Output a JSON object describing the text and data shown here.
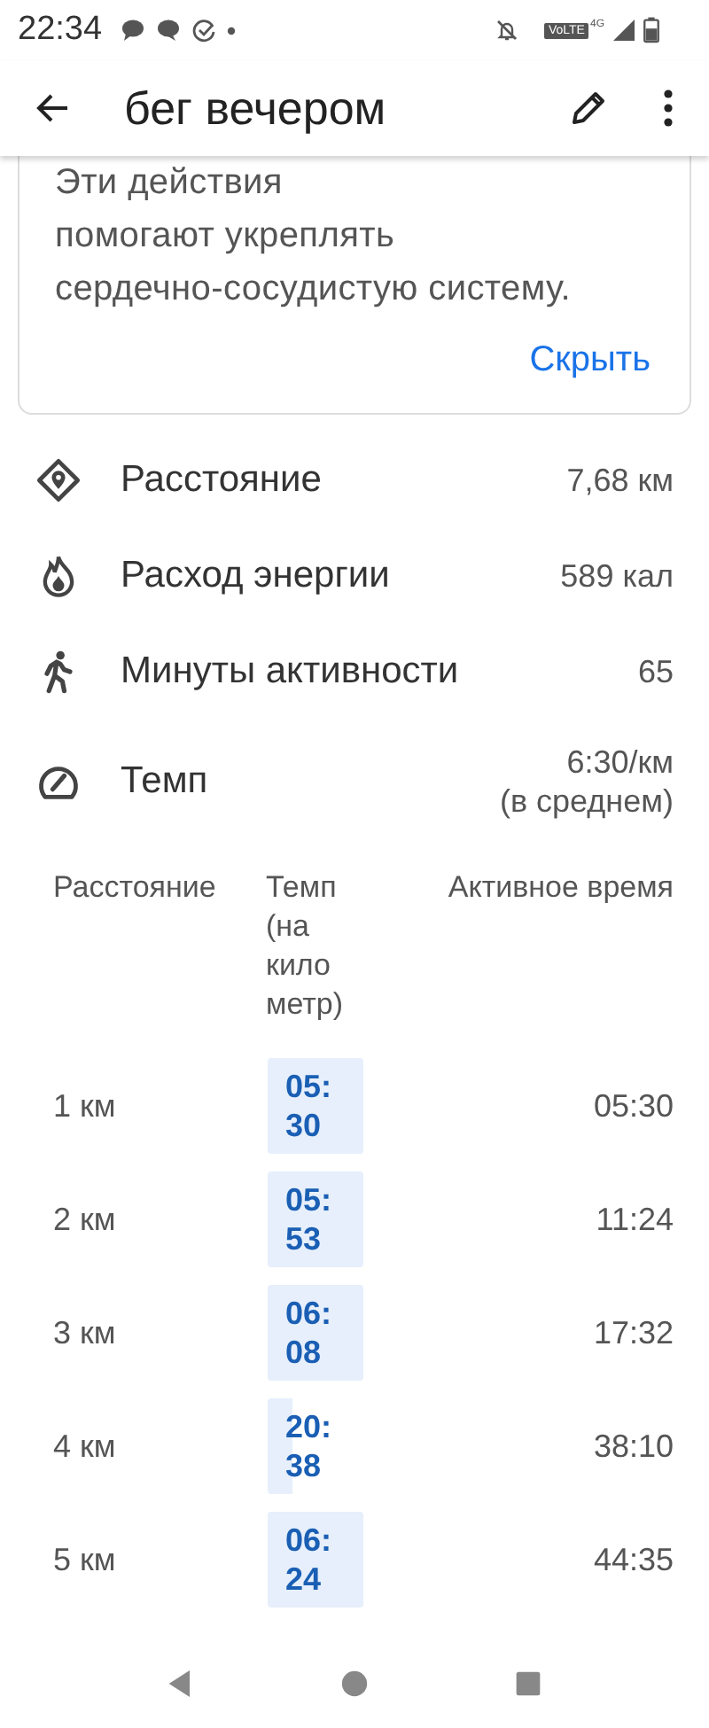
{
  "status_bar": {
    "time": "22:34",
    "network": "VoLTE",
    "network_sup": "4G"
  },
  "app_bar": {
    "title": "бег вечером"
  },
  "info_card": {
    "lines": [
      "Эти действия",
      "помогают укреплять",
      "сердечно-сосудистую систему."
    ],
    "action": "Скрыть"
  },
  "stats": [
    {
      "kind": "distance",
      "label": "Расстояние",
      "value": "7,68 км"
    },
    {
      "kind": "energy",
      "label": "Расход энергии",
      "value": "589 кал"
    },
    {
      "kind": "active",
      "label": "Минуты активности",
      "value": "65"
    },
    {
      "kind": "pace",
      "label": "Темп",
      "value": "6:30/км",
      "note": "(в среднем)"
    }
  ],
  "splits": {
    "columns": [
      "Расстояние",
      "Темп (на кило метр)",
      "Активное время"
    ],
    "rows": [
      {
        "kind": "full",
        "distance": "1 км",
        "pace": "05: 30",
        "time": "05:30"
      },
      {
        "kind": "full",
        "distance": "2 км",
        "pace": "05: 53",
        "time": "11:24"
      },
      {
        "kind": "full",
        "distance": "3 км",
        "pace": "06: 08",
        "time": "17:32"
      },
      {
        "kind": "short",
        "distance": "4 км",
        "pace": "20: 38",
        "time": "38:10"
      },
      {
        "kind": "full",
        "distance": "5 км",
        "pace": "06: 24",
        "time": "44:35"
      }
    ]
  }
}
